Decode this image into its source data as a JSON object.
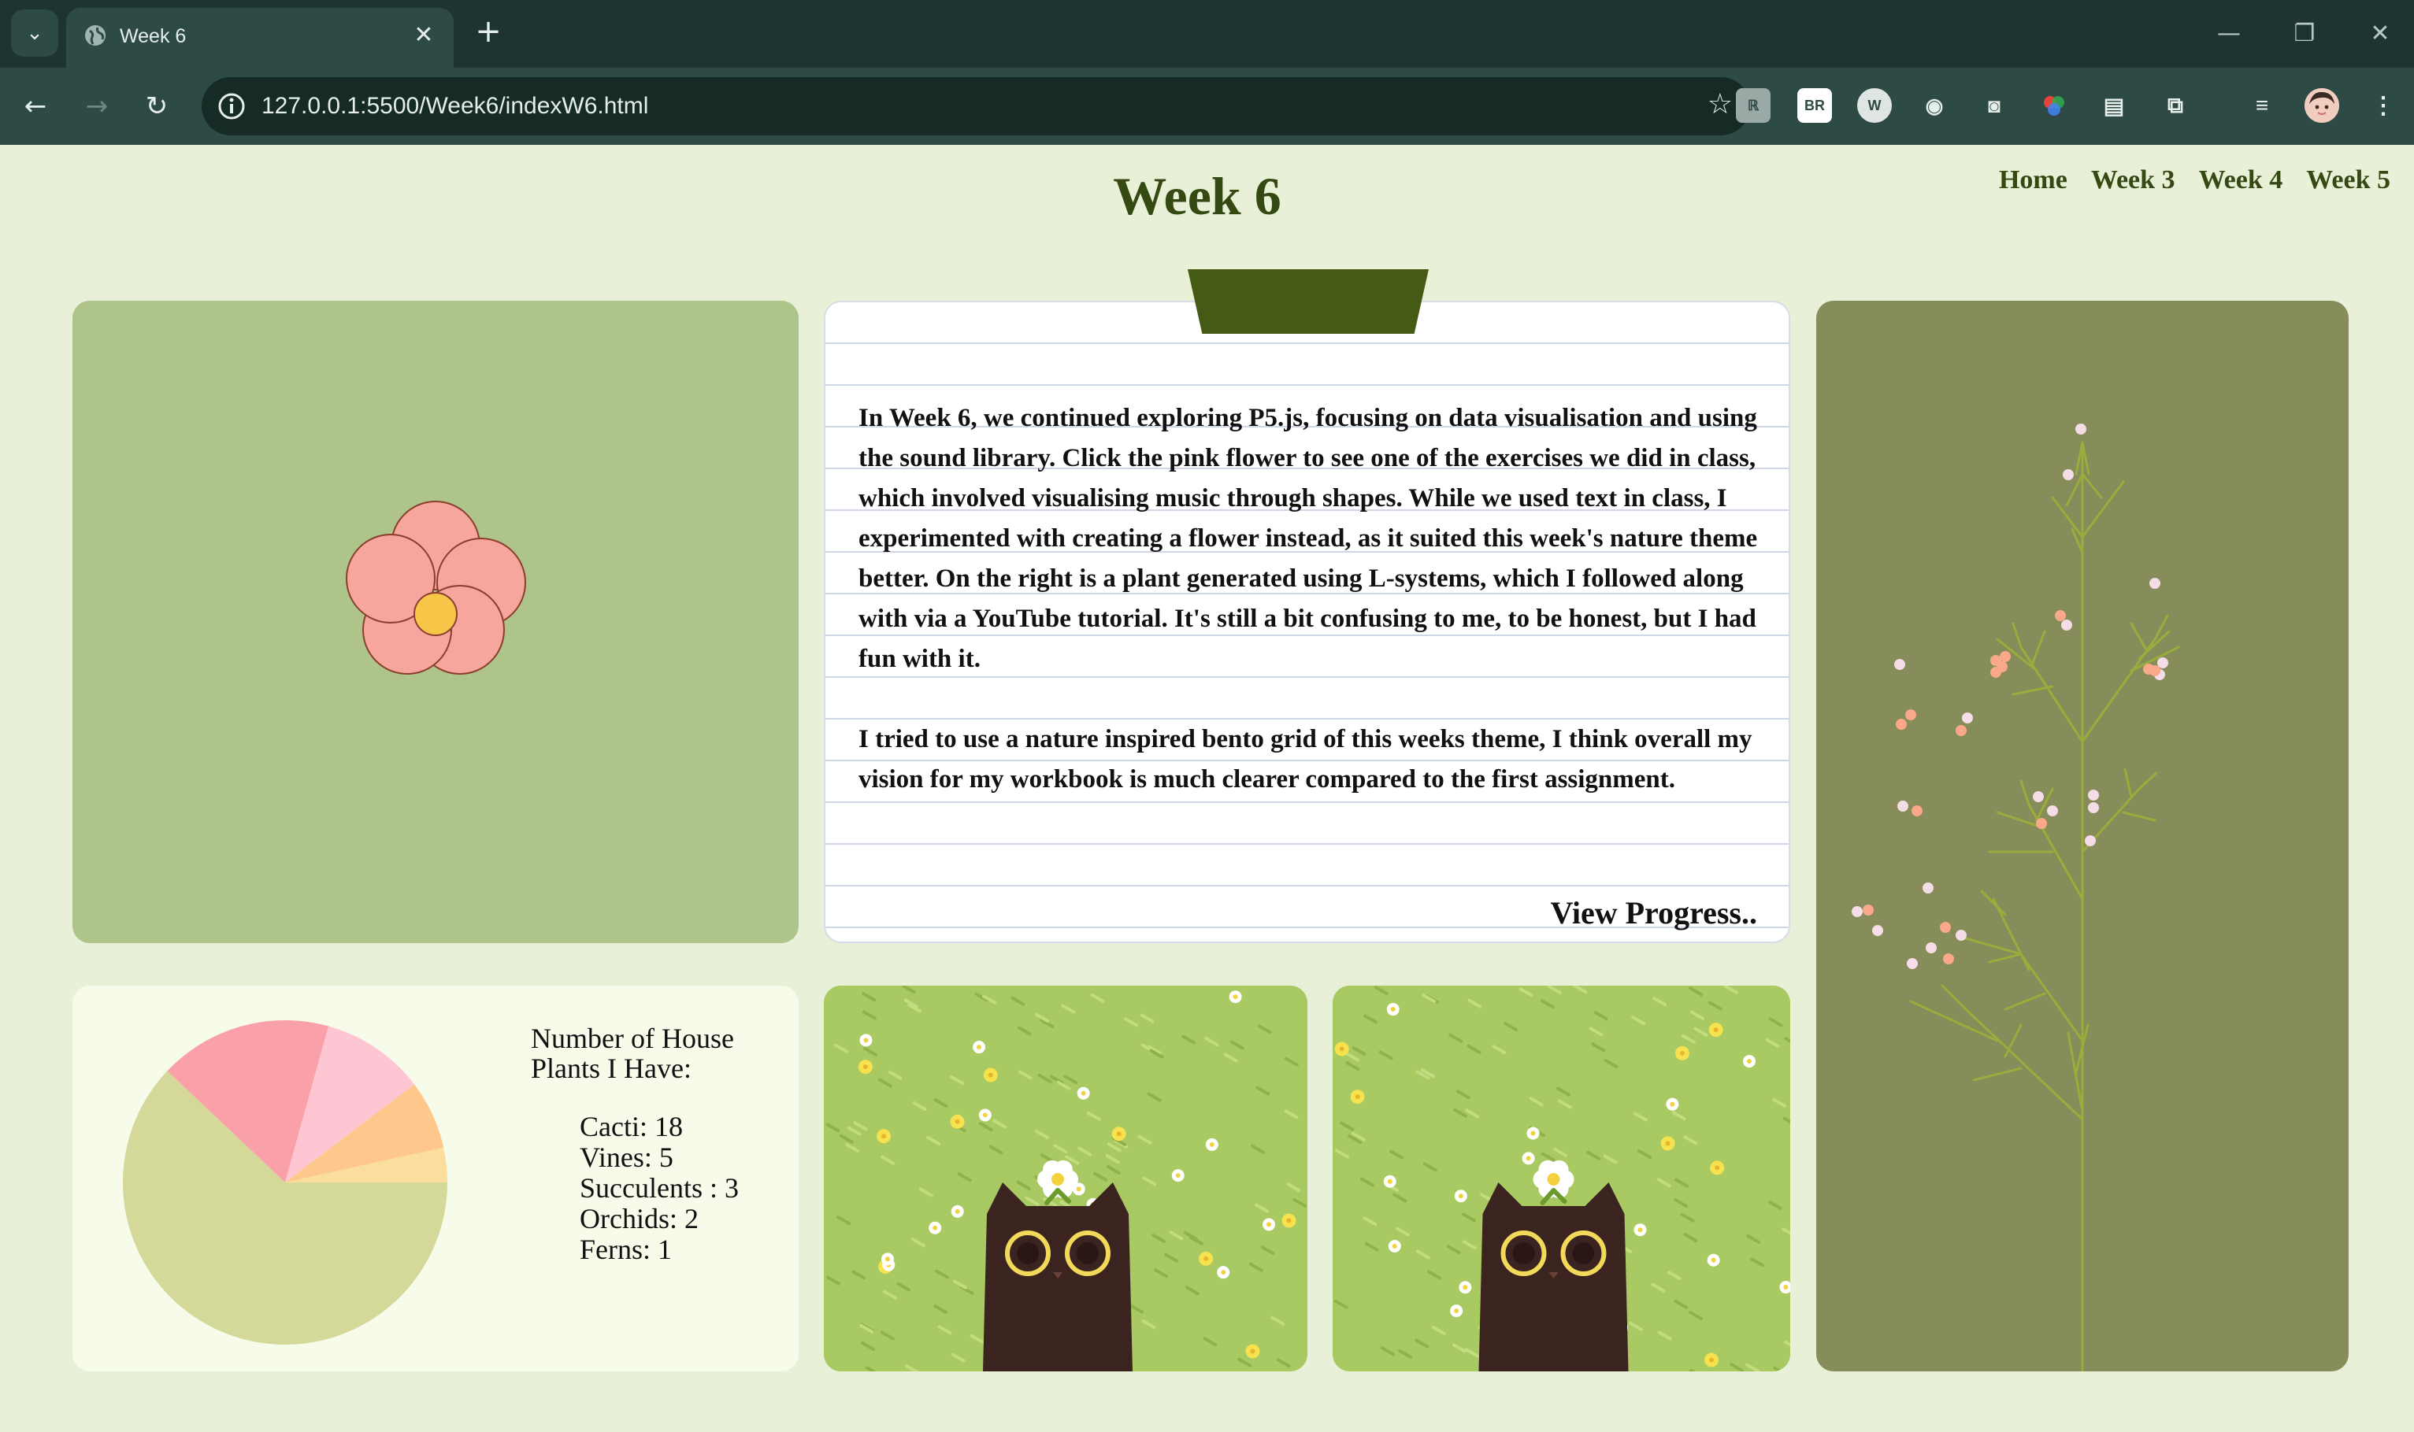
{
  "browser": {
    "tab_title": "Week 6",
    "url": "127.0.0.1:5500/Week6/indexW6.html",
    "extensions": [
      "BR"
    ]
  },
  "page": {
    "title": "Week 6",
    "nav": [
      "Home",
      "Week 3",
      "Week 4",
      "Week 5"
    ]
  },
  "notebook": {
    "paragraph1": "In Week 6, we continued exploring P5.js, focusing on data visualisation and using the sound library. Click the pink flower to see one of the exercises we did in class, which involved visualising music through shapes. While we used text in class, I experimented with creating a flower instead, as it suited this week's nature theme better. On the right is a plant generated using L-systems, which I followed along with via a YouTube tutorial. It's still a bit confusing to me, to be honest, but I had fun with it.",
    "paragraph2": "I tried to use a nature inspired bento grid of this weeks theme, I think overall my vision for my workbook is much clearer compared to the first assignment.",
    "link": "View Progress.."
  },
  "plants": {
    "heading": "Number of House Plants I Have:",
    "items": [
      "Cacti: 18",
      "Vines: 5",
      "Succulents : 3",
      "Orchids: 2",
      "Ferns: 1"
    ]
  },
  "chart_data": {
    "type": "pie",
    "categories": [
      "Cacti",
      "Vines",
      "Succulents",
      "Orchids",
      "Ferns"
    ],
    "values": [
      18,
      5,
      3,
      2,
      1
    ],
    "colors": [
      "#d4d99a",
      "#f9a0a8",
      "#fdc6d2",
      "#fec88c",
      "#fbdd9e"
    ]
  },
  "colors": {
    "background": "#e8f0d8",
    "heading": "#354a12",
    "flower_card": "#aec48a",
    "plant_card": "#868c5a",
    "tape": "#455a15",
    "flower_petal": "#f7a69e",
    "flower_center": "#f7c548"
  }
}
